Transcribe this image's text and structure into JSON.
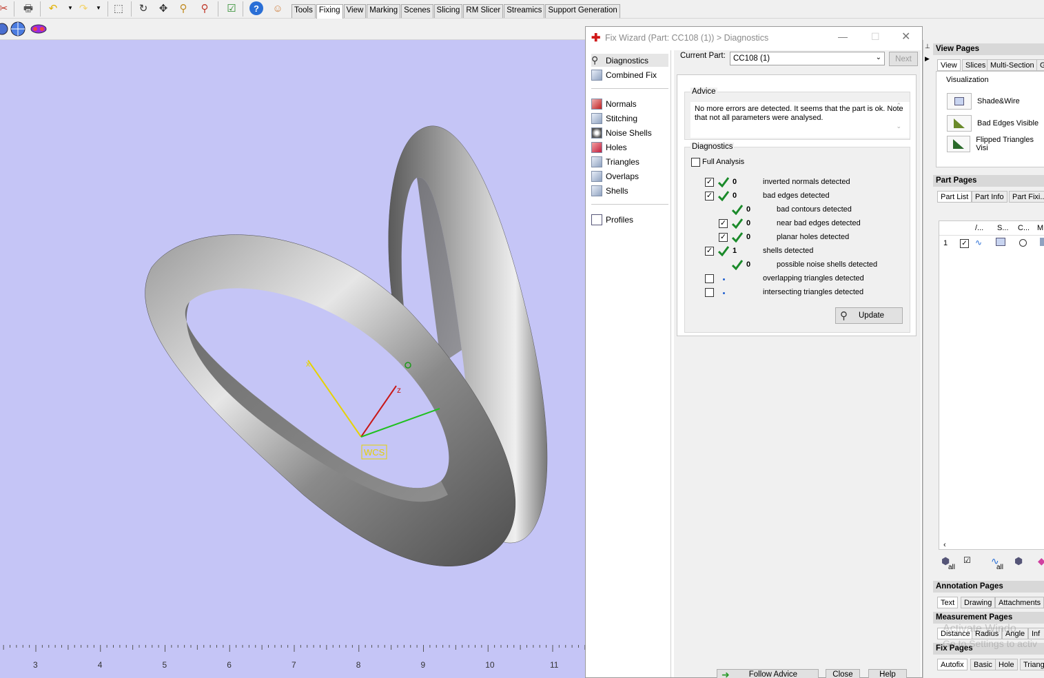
{
  "toolbar": {
    "tabs": [
      "Tools",
      "Fixing",
      "View",
      "Marking",
      "Scenes",
      "Slicing",
      "RM Slicer",
      "Streamics",
      "Support Generation"
    ],
    "active_tab": "Fixing"
  },
  "viewport": {
    "wcs_label": "WCS",
    "axis_labels": {
      "x": "x",
      "z": "z"
    },
    "ruler_ticks": [
      "3",
      "4",
      "5",
      "6",
      "7",
      "8",
      "9",
      "10",
      "11"
    ]
  },
  "wizard": {
    "title": "Fix Wizard (Part: CC108 (1)) > Diagnostics",
    "nav": {
      "top": [
        "Diagnostics",
        "Combined Fix"
      ],
      "fixes": [
        "Normals",
        "Stitching",
        "Noise Shells",
        "Holes",
        "Triangles",
        "Overlaps",
        "Shells"
      ],
      "bottom": [
        "Profiles"
      ],
      "selected": "Diagnostics"
    },
    "current_part_label": "Current Part:",
    "current_part_value": "CC108 (1)",
    "next_label": "Next",
    "advice_title": "Advice",
    "advice_text": "No more errors are detected. It seems that the part is ok. Note that not all parameters were analysed.",
    "diagnostics_title": "Diagnostics",
    "full_analysis_label": "Full Analysis",
    "rows": [
      {
        "checkbox": true,
        "checked": true,
        "status": "ok",
        "count": "0",
        "label": "inverted normals detected",
        "indent": 0
      },
      {
        "checkbox": true,
        "checked": true,
        "status": "ok",
        "count": "0",
        "label": "bad edges detected",
        "indent": 0
      },
      {
        "checkbox": false,
        "checked": false,
        "status": "ok",
        "count": "0",
        "label": "bad contours detected",
        "indent": 1
      },
      {
        "checkbox": true,
        "checked": true,
        "status": "ok",
        "count": "0",
        "label": "near bad edges detected",
        "indent": 1
      },
      {
        "checkbox": true,
        "checked": true,
        "status": "ok",
        "count": "0",
        "label": "planar holes detected",
        "indent": 1
      },
      {
        "checkbox": true,
        "checked": true,
        "status": "ok",
        "count": "1",
        "label": "shells detected",
        "indent": 0
      },
      {
        "checkbox": false,
        "checked": false,
        "status": "ok",
        "count": "0",
        "label": "possible noise shells detected",
        "indent": 1
      },
      {
        "checkbox": true,
        "checked": false,
        "status": "dot",
        "count": "",
        "label": "overlapping triangles detected",
        "indent": 0
      },
      {
        "checkbox": true,
        "checked": false,
        "status": "dot",
        "count": "",
        "label": "intersecting triangles detected",
        "indent": 0
      }
    ],
    "update_label": "Update",
    "footer_buttons": [
      "Follow Advice",
      "Close",
      "Help"
    ]
  },
  "right_pane": {
    "view_pages_title": "View Pages",
    "view_tabs": [
      "View",
      "Slices",
      "Multi-Section",
      "G"
    ],
    "visualization_title": "Visualization",
    "visualization_items": [
      "Shade&Wire",
      "Bad Edges Visible",
      "Flipped Triangles Visi"
    ],
    "part_pages_title": "Part Pages",
    "part_tabs": [
      "Part List",
      "Part Info",
      "Part Fixi..."
    ],
    "part_columns": [
      "/...",
      "S...",
      "C...",
      "M..."
    ],
    "part_row_index": "1",
    "part_footer_labels": [
      "all",
      "all"
    ],
    "annotation_pages_title": "Annotation Pages",
    "annotation_tabs": [
      "Text",
      "Drawing",
      "Attachments"
    ],
    "measurement_pages_title": "Measurement Pages",
    "measurement_tabs": [
      "Distance",
      "Radius",
      "Angle",
      "Inf"
    ],
    "fix_pages_title": "Fix Pages",
    "fix_tabs": [
      "Autofix",
      "Basic",
      "Hole",
      "Triangle"
    ],
    "watermark_line1": "Activate Windo",
    "watermark_line2": "Go to Settings to activ"
  }
}
